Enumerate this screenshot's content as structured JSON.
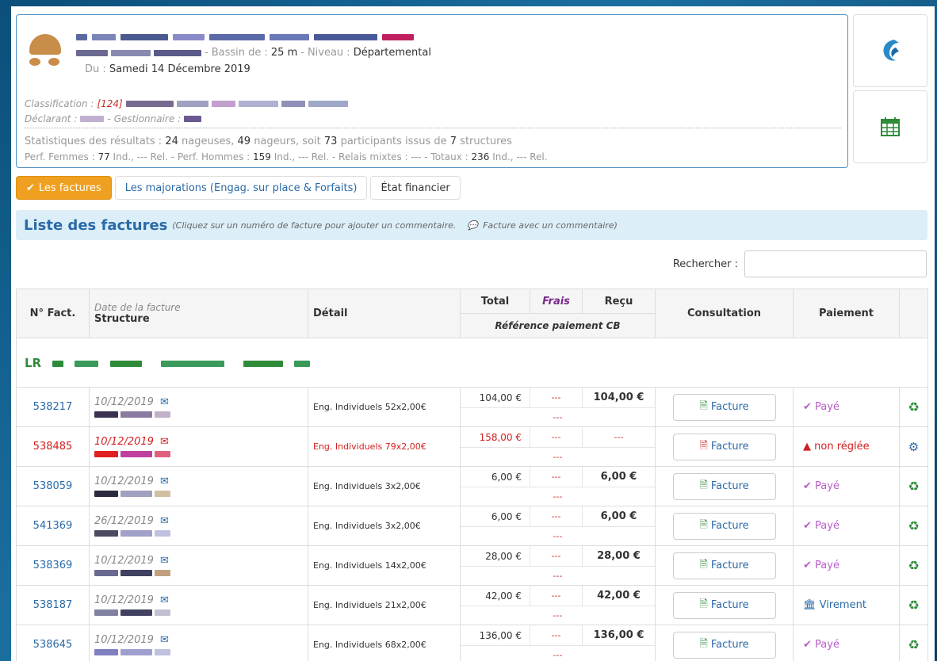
{
  "meet": {
    "bassin_label": "Bassin de :",
    "bassin_value": "25 m",
    "niveau_label": "Niveau :",
    "niveau_value": "Départemental",
    "date_label": "Du :",
    "date_value": "Samedi 14 Décembre 2019",
    "classification_label": "Classification :",
    "classification_code": "[124]",
    "declarant_label": "Déclarant :",
    "gestionnaire_label": "Gestionnaire :"
  },
  "stats": {
    "line1_prefix": "Statistiques des résultats :",
    "nageuses_count": "24",
    "nageuses_label": "nageuses,",
    "nageurs_count": "49",
    "nageurs_label": "nageurs, soit",
    "participants_count": "73",
    "participants_label": "participants issus de",
    "structures_count": "7",
    "structures_label": "structures",
    "perf_femmes_label": "Perf. Femmes :",
    "perf_femmes_ind": "77",
    "perf_femmes_rest": "Ind., --- Rel. - Perf. Hommes :",
    "perf_hommes_ind": "159",
    "perf_hommes_rest": "Ind., --- Rel. - Relais mixtes : --- - Totaux :",
    "totaux_ind": "236",
    "totaux_rest": "Ind., --- Rel."
  },
  "tabs": [
    {
      "label": "Les factures"
    },
    {
      "label": "Les majorations (Engag. sur place & Forfaits)"
    },
    {
      "label": "État financier"
    }
  ],
  "list": {
    "title": "Liste des factures",
    "hint": "(Cliquez sur un numéro de facture pour ajouter un commentaire.",
    "hint2": "Facture avec un commentaire)",
    "search_label": "Rechercher :"
  },
  "table_head": {
    "num": "N° Fact.",
    "date": "Date de la facture",
    "structure": "Structure",
    "detail": "Détail",
    "total": "Total",
    "frais": "Frais",
    "recu": "Reçu",
    "ref": "Référence paiement CB",
    "consultation": "Consultation",
    "paiement": "Paiement"
  },
  "org_prefix": "LR",
  "rows": [
    {
      "num": "538217",
      "date": "10/12/2019",
      "detail": "Eng. Individuels 52x2,00€",
      "total": "104,00 €",
      "frais": "---",
      "recu": "104,00 €",
      "ref": "---",
      "facture": "Facture",
      "paiement": "Payé",
      "status": "paye"
    },
    {
      "num": "538485",
      "date": "10/12/2019",
      "detail": "Eng. Individuels 79x2,00€",
      "total": "158,00 €",
      "frais": "---",
      "recu": "---",
      "ref": "---",
      "facture": "Facture",
      "paiement": "non réglée",
      "status": "nonreg"
    },
    {
      "num": "538059",
      "date": "10/12/2019",
      "detail": "Eng. Individuels 3x2,00€",
      "total": "6,00 €",
      "frais": "---",
      "recu": "6,00 €",
      "ref": "---",
      "facture": "Facture",
      "paiement": "Payé",
      "status": "paye"
    },
    {
      "num": "541369",
      "date": "26/12/2019",
      "detail": "Eng. Individuels 3x2,00€",
      "total": "6,00 €",
      "frais": "---",
      "recu": "6,00 €",
      "ref": "---",
      "facture": "Facture",
      "paiement": "Payé",
      "status": "paye"
    },
    {
      "num": "538369",
      "date": "10/12/2019",
      "detail": "Eng. Individuels 14x2,00€",
      "total": "28,00 €",
      "frais": "---",
      "recu": "28,00 €",
      "ref": "---",
      "facture": "Facture",
      "paiement": "Payé",
      "status": "paye"
    },
    {
      "num": "538187",
      "date": "10/12/2019",
      "detail": "Eng. Individuels 21x2,00€",
      "total": "42,00 €",
      "frais": "---",
      "recu": "42,00 €",
      "ref": "---",
      "facture": "Facture",
      "paiement": "Virement",
      "status": "vir"
    },
    {
      "num": "538645",
      "date": "10/12/2019",
      "detail": "Eng. Individuels 68x2,00€",
      "total": "136,00 €",
      "frais": "---",
      "recu": "136,00 €",
      "ref": "---",
      "facture": "Facture",
      "paiement": "Payé",
      "status": "paye"
    }
  ],
  "colors": {
    "accent": "#2a6aa7",
    "active_tab": "#f0a020",
    "error": "#d21e1e",
    "paid": "#b85cc9",
    "ok_green": "#2e8b3a"
  }
}
